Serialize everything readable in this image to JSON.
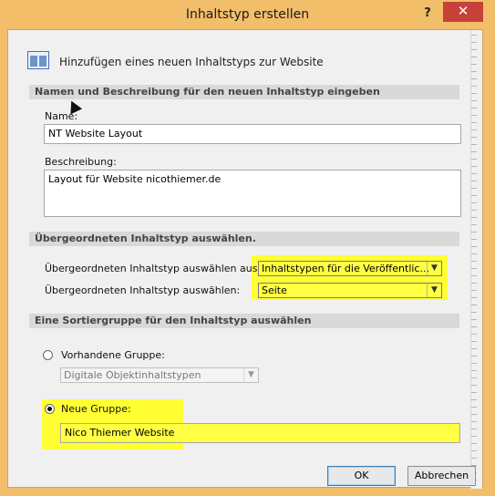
{
  "window": {
    "title": "Inhaltstyp erstellen",
    "help_label": "?",
    "close_label": "✕"
  },
  "header": {
    "icon": "content-type-icon",
    "text": "Hinzufügen eines neuen Inhaltstyps zur Website"
  },
  "section_name": {
    "title": "Namen und Beschreibung für den neuen Inhaltstyp eingeben",
    "name_label": "Name:",
    "name_value": "NT Website Layout",
    "description_label": "Beschreibung:",
    "description_value": "Layout für Website nicothiemer.de"
  },
  "section_parent": {
    "title": "Übergeordneten Inhaltstyp auswählen.",
    "from_label": "Übergeordneten Inhaltstyp auswählen aus:",
    "from_value": "Inhaltstypen für die Veröffentlic...",
    "type_label": "Übergeordneten Inhaltstyp auswählen:",
    "type_value": "Seite"
  },
  "section_group": {
    "title": "Eine Sortiergruppe für den Inhaltstyp auswählen",
    "existing_label": "Vorhandene Gruppe:",
    "existing_value": "Digitale Objektinhaltstypen",
    "new_label": "Neue Gruppe:",
    "new_value": "Nico Thiemer Website"
  },
  "buttons": {
    "ok": "OK",
    "cancel": "Abbrechen"
  },
  "colors": {
    "highlight": "#ffff33",
    "title_bar": "#f3be6a",
    "close_button": "#c7413a"
  }
}
